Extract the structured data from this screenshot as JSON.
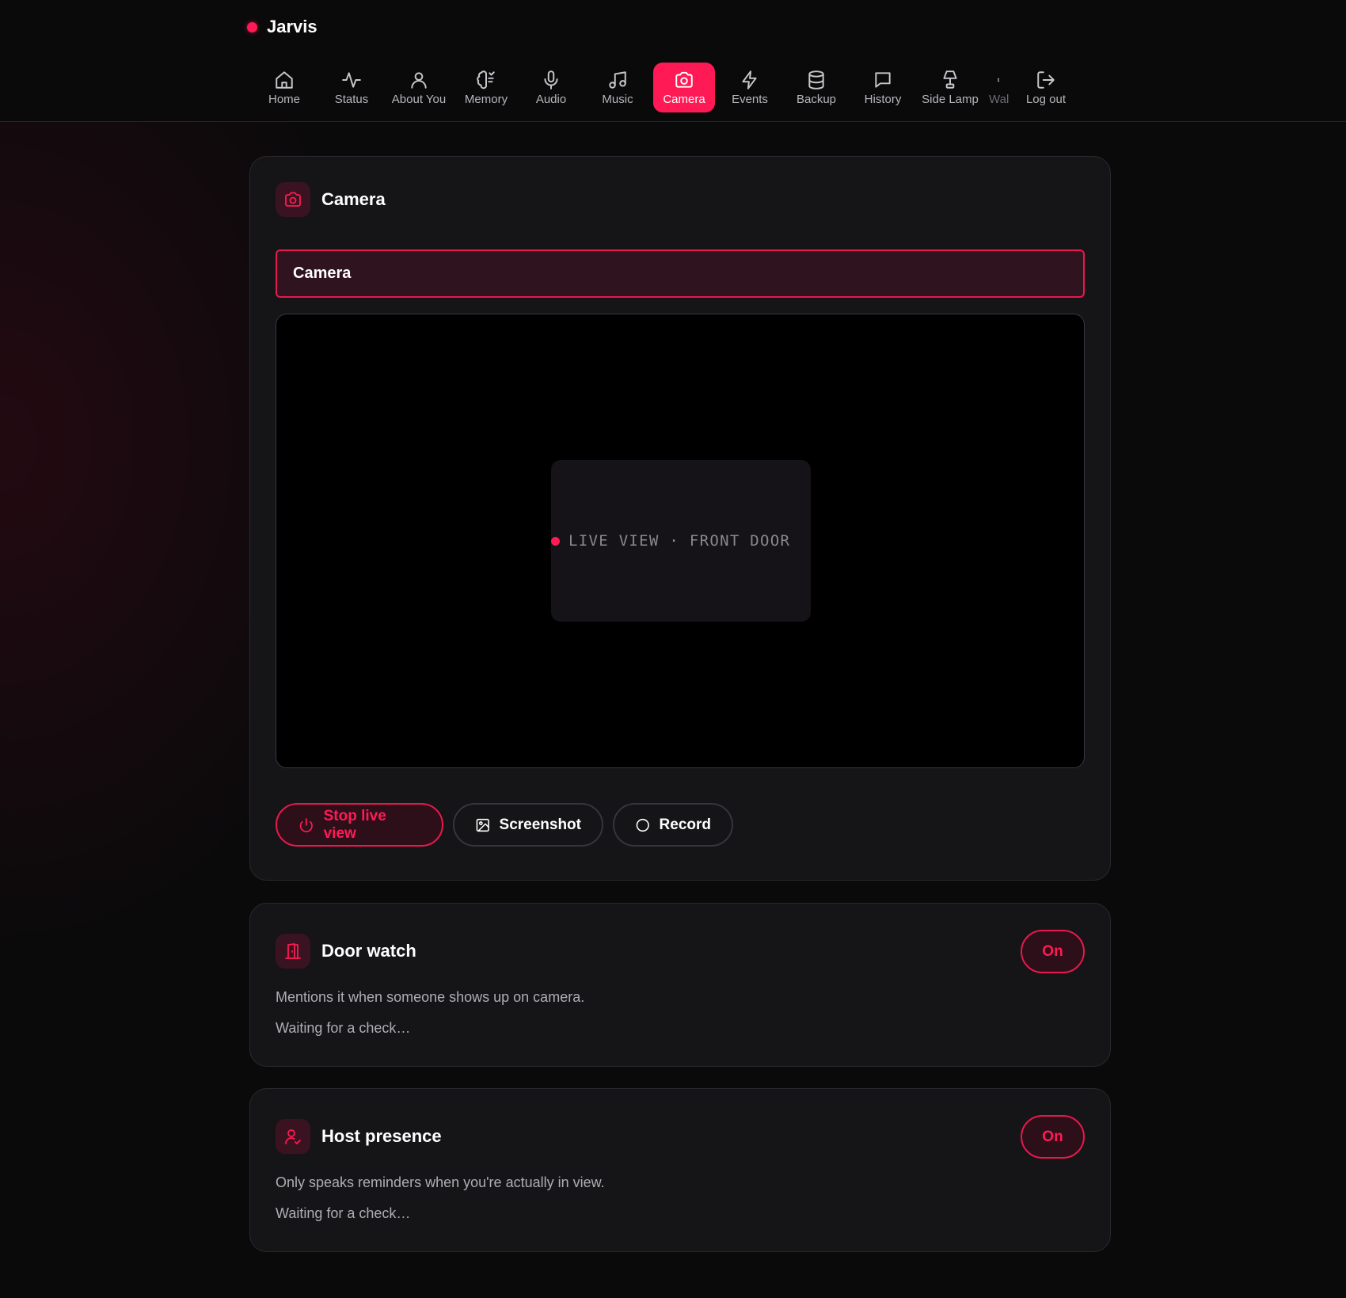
{
  "app": {
    "name": "Jarvis",
    "accent": "#ff1a55"
  },
  "nav": {
    "items": [
      {
        "label": "Home",
        "icon": "home-icon"
      },
      {
        "label": "Status",
        "icon": "activity-icon"
      },
      {
        "label": "About You",
        "icon": "user-icon"
      },
      {
        "label": "Memory",
        "icon": "brain-icon"
      },
      {
        "label": "Audio",
        "icon": "microphone-icon"
      },
      {
        "label": "Music",
        "icon": "music-note-icon"
      },
      {
        "label": "Camera",
        "icon": "camera-icon",
        "active": true
      },
      {
        "label": "Events",
        "icon": "lightning-icon"
      },
      {
        "label": "Backup",
        "icon": "database-icon"
      },
      {
        "label": "History",
        "icon": "chat-bubble-icon"
      },
      {
        "label": "Side Lamp",
        "icon": "lamp-icon"
      },
      {
        "label": "Wal",
        "icon": "clipped-icon"
      },
      {
        "label": "Log out",
        "icon": "logout-icon"
      }
    ]
  },
  "camera_card": {
    "title": "Camera",
    "selector_value": "Camera",
    "live_label": "LIVE VIEW · FRONT DOOR",
    "actions": {
      "stop": "Stop live view",
      "screenshot": "Screenshot",
      "record": "Record"
    }
  },
  "door_watch": {
    "title": "Door watch",
    "toggle": "On",
    "description": "Mentions it when someone shows up on camera.",
    "status": "Waiting for a check…"
  },
  "host_presence": {
    "title": "Host presence",
    "toggle": "On",
    "description": "Only speaks reminders when you're actually in view.",
    "status": "Waiting for a check…"
  }
}
